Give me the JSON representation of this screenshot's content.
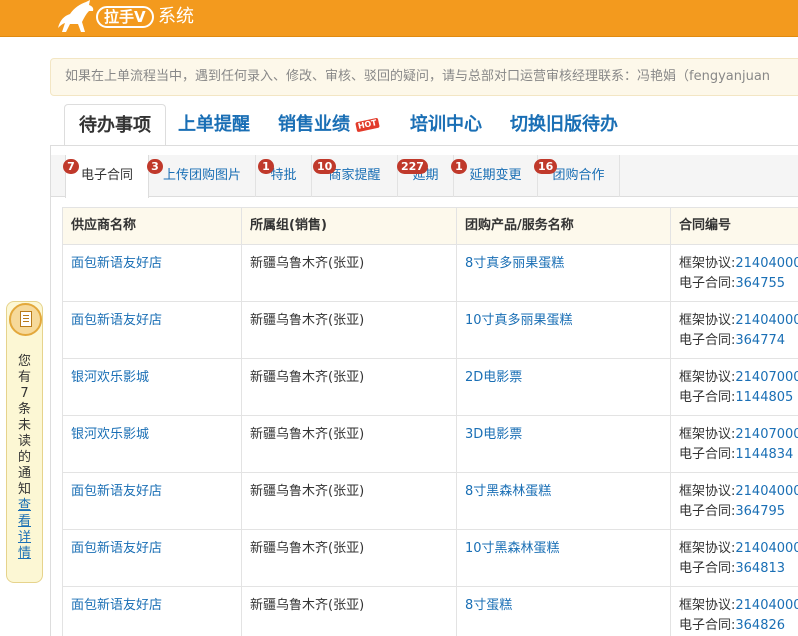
{
  "header": {
    "badge": "拉手V",
    "system": "系统"
  },
  "notice": "如果在上单流程当中，遇到任何录入、修改、审核、驳回的疑问，请与总部对口运营审核经理联系：冯艳娟（fengyanjuan",
  "main_tabs": [
    {
      "label": "待办事项"
    },
    {
      "label": "上单提醒"
    },
    {
      "label": "销售业绩"
    },
    {
      "label": "培训中心"
    },
    {
      "label": "切换旧版待办"
    }
  ],
  "hot_label": "HOT",
  "sub_tabs": [
    {
      "label": "电子合同",
      "count": "7"
    },
    {
      "label": "上传团购图片",
      "count": "3"
    },
    {
      "label": "特批",
      "count": "1"
    },
    {
      "label": "商家提醒",
      "count": "10"
    },
    {
      "label": "延期",
      "count": "227"
    },
    {
      "label": "延期变更",
      "count": "1"
    },
    {
      "label": "团购合作",
      "count": "16"
    }
  ],
  "table": {
    "headers": [
      "供应商名称",
      "所属组(销售)",
      "团购产品/服务名称",
      "合同编号"
    ],
    "framework_prefix": "框架协议:",
    "contract_prefix": "电子合同:",
    "rows": [
      {
        "supplier": "面包新语友好店",
        "group": "新疆乌鲁木齐(张亚)",
        "product": "8寸真多丽果蛋糕",
        "framework": "21404000",
        "contract": "364755"
      },
      {
        "supplier": "面包新语友好店",
        "group": "新疆乌鲁木齐(张亚)",
        "product": "10寸真多丽果蛋糕",
        "framework": "21404000",
        "contract": "364774"
      },
      {
        "supplier": "银河欢乐影城",
        "group": "新疆乌鲁木齐(张亚)",
        "product": "2D电影票",
        "framework": "21407000",
        "contract": "1144805"
      },
      {
        "supplier": "银河欢乐影城",
        "group": "新疆乌鲁木齐(张亚)",
        "product": "3D电影票",
        "framework": "21407000",
        "contract": "1144834"
      },
      {
        "supplier": "面包新语友好店",
        "group": "新疆乌鲁木齐(张亚)",
        "product": "8寸黑森林蛋糕",
        "framework": "21404000",
        "contract": "364795"
      },
      {
        "supplier": "面包新语友好店",
        "group": "新疆乌鲁木齐(张亚)",
        "product": "10寸黑森林蛋糕",
        "framework": "21404000",
        "contract": "364813"
      },
      {
        "supplier": "面包新语友好店",
        "group": "新疆乌鲁木齐(张亚)",
        "product": "8寸蛋糕",
        "framework": "21404000",
        "contract": "364826"
      }
    ]
  },
  "notification": {
    "text_chars": [
      "您",
      "有",
      "7",
      "条",
      "未",
      "读",
      "的",
      "通",
      "知"
    ],
    "link_chars": [
      "查",
      "看",
      "详",
      "情"
    ]
  }
}
